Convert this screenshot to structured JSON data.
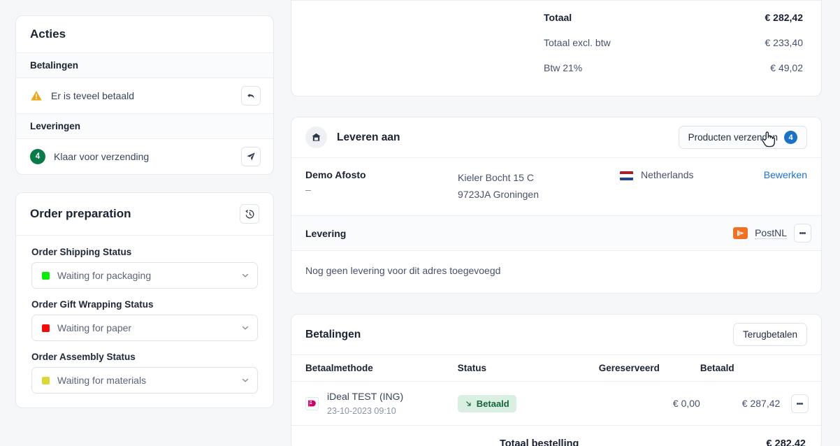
{
  "sidebar": {
    "actions_card": {
      "title": "Acties",
      "groups": [
        {
          "label": "Betalingen",
          "items": [
            {
              "icon": "warning-triangle-icon",
              "label": "Er is teveel betaald",
              "action_icon": "undo-arrow-icon",
              "badge": null
            }
          ]
        },
        {
          "label": "Leveringen",
          "items": [
            {
              "icon": "count-badge",
              "label": "Klaar voor verzending",
              "action_icon": "send-plane-icon",
              "badge": "4"
            }
          ]
        }
      ]
    },
    "prep_card": {
      "title": "Order preparation",
      "history_icon": "history-clock-icon",
      "fields": [
        {
          "label": "Order Shipping Status",
          "value": "Waiting for packaging",
          "color": "#08ee08"
        },
        {
          "label": "Order Gift Wrapping Status",
          "value": "Waiting for paper",
          "color": "#f50a0a"
        },
        {
          "label": "Order Assembly Status",
          "value": "Waiting for materials",
          "color": "#d9d93a"
        }
      ]
    }
  },
  "totals": {
    "rows": [
      {
        "label": "Totaal",
        "value": "€ 282,42",
        "strong": true
      },
      {
        "label": "Totaal excl. btw",
        "value": "€ 233,40",
        "strong": false
      },
      {
        "label": "Btw 21%",
        "value": "€ 49,02",
        "strong": false
      }
    ]
  },
  "deliver": {
    "title": "Leveren aan",
    "home_icon": "home-icon",
    "ship_button": {
      "label": "Producten verzenden",
      "count": "4"
    },
    "address": {
      "name": "Demo Afosto",
      "dash": "–",
      "street": "Kieler Bocht 15 C",
      "city": "9723JA Groningen",
      "country": "Netherlands",
      "edit_link": "Bewerken"
    },
    "levering": {
      "title": "Levering",
      "carrier": "PostNL",
      "carrier_icon": "postnl-logo-icon",
      "menu_icon": "kebab-menu-icon",
      "empty_text": "Nog geen levering voor dit adres toegevoegd"
    }
  },
  "payments": {
    "title": "Betalingen",
    "refund_button": "Terugbetalen",
    "columns": [
      "Betaalmethode",
      "Status",
      "Gereserveerd",
      "Betaald"
    ],
    "rows": [
      {
        "method": "iDeal TEST (ING)",
        "method_icon": "ideal-logo-icon",
        "date": "23-10-2023 09:10",
        "status": "Betaald",
        "status_icon": "arrow-down-right-icon",
        "reserved": "€ 0,00",
        "paid": "€ 287,42",
        "menu_icon": "kebab-menu-icon"
      }
    ],
    "footer": {
      "label": "Totaal bestelling",
      "value": "€ 282,42"
    }
  },
  "colors": {
    "accent_blue": "#1b72c4",
    "badge_green": "#0b7a4b",
    "status_bg": "#d9efe1",
    "status_text": "#15653c",
    "postnl_orange": "#f27022"
  }
}
